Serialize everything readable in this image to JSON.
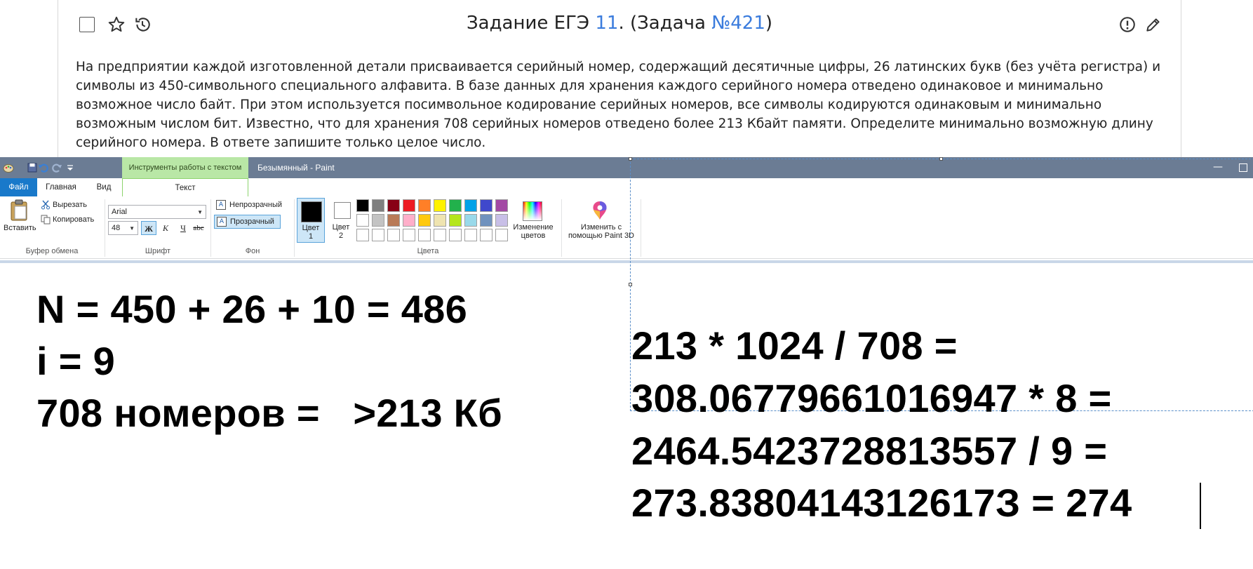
{
  "task": {
    "title_prefix": "Задание ЕГЭ ",
    "task_number": "11",
    "title_middle": ". (Задача ",
    "problem_link": "№421",
    "title_suffix": ")",
    "text": "На предприятии каждой изготовленной детали присваивается серийный номер, содержащий десятичные цифры, 26 латинских букв (без учёта регистра) и символы из 450-символьного специального алфавита. В базе данных для хранения каждого серийного номера отведено одинаковое и минимально возможное число байт. При этом используется посимвольное кодирование серийных номеров, все символы кодируются одинаковым и минимально возможным числом бит. Известно, что для хранения 708 серийных номеров отведено более 213 Кбайт памяти. Определите минимально возможную длину серийного номера. В ответе запишите только целое число."
  },
  "paint": {
    "context_tab": "Инструменты работы с текстом",
    "window_title": "Безымянный - Paint",
    "tabs": {
      "file": "Файл",
      "home": "Главная",
      "view": "Вид",
      "text": "Текст"
    },
    "clipboard": {
      "paste": "Вставить",
      "cut": "Вырезать",
      "copy": "Копировать",
      "group": "Буфер обмена"
    },
    "font": {
      "family": "Arial",
      "size": "48",
      "bold": "Ж",
      "italic": "К",
      "underline": "Ч",
      "strike": "abc",
      "group": "Шрифт"
    },
    "background": {
      "opaque": "Непрозрачный",
      "transparent": "Прозрачный",
      "group": "Фон"
    },
    "colors": {
      "color1_line1": "Цвет",
      "color1_line2": "1",
      "color2_line1": "Цвет",
      "color2_line2": "2",
      "edit_line1": "Изменение",
      "edit_line2": "цветов",
      "group": "Цвета",
      "palette_row1": [
        "#000000",
        "#7f7f7f",
        "#880015",
        "#ed1c24",
        "#ff7f27",
        "#fff200",
        "#22b14c",
        "#00a2e8",
        "#3f48cc",
        "#a349a4"
      ],
      "palette_row2": [
        "#ffffff",
        "#c3c3c3",
        "#b97a57",
        "#ffaec9",
        "#ffc90e",
        "#efe4b0",
        "#b5e61d",
        "#99d9ea",
        "#7092be",
        "#c8bfe7"
      ]
    },
    "paint3d": {
      "line1": "Изменить с",
      "line2": "помощью Paint 3D"
    }
  },
  "canvas": {
    "left_lines": [
      "N = 450 + 26 + 10 = 486",
      "i = 9",
      "708 номеров =   >213 Кб"
    ],
    "right_lines": [
      "213 * 1024 / 708 =",
      "308.06779661016947 * 8 =",
      "2464.5423728813557 / 9 =",
      "273.8380414312617З = 274"
    ]
  }
}
